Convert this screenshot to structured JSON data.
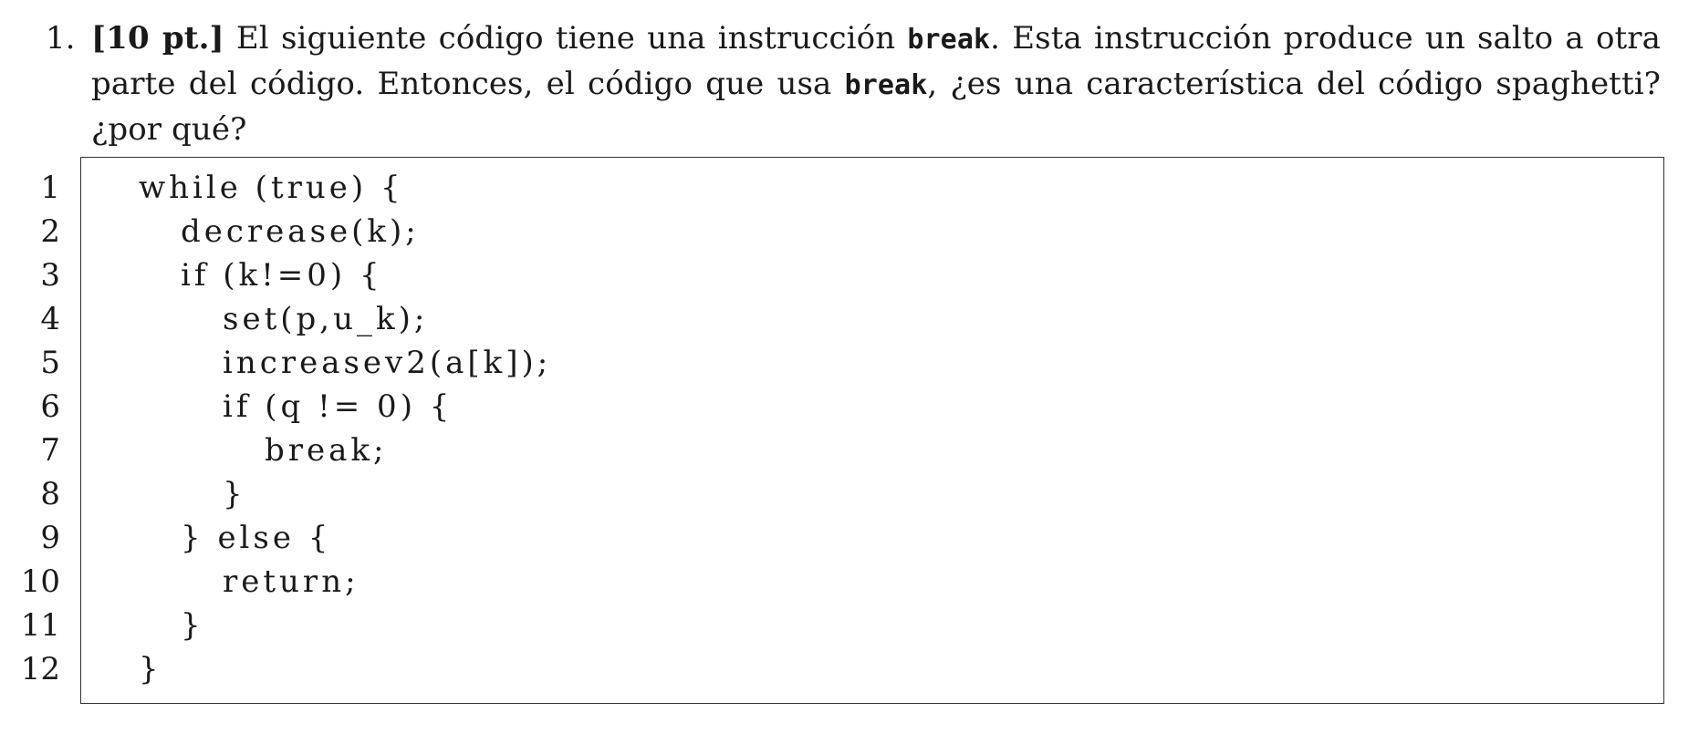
{
  "question": {
    "number": "1.",
    "points": "[10 pt.]",
    "text_1": " El siguiente código tiene una instrucción ",
    "keyword_1": "break",
    "text_2": ". Esta instrucción produce un salto a otra parte del código. Entonces, el código que usa ",
    "keyword_2": "break",
    "text_3": ", ¿es una característica del código spaghetti? ¿por qué?"
  },
  "code": {
    "line_numbers": [
      "1",
      "2",
      "3",
      "4",
      "5",
      "6",
      "7",
      "8",
      "9",
      "10",
      "11",
      "12"
    ],
    "lines": [
      "while (true) {",
      "decrease(k);",
      "if (k!=0) {",
      "set(p,u_k);",
      "increasev2(a[k]);",
      "if (q != 0) {",
      "break;",
      "}",
      "} else {",
      "return;",
      "}",
      "}"
    ],
    "indent_levels": [
      0,
      1,
      1,
      2,
      2,
      2,
      3,
      2,
      1,
      2,
      1,
      0
    ]
  }
}
